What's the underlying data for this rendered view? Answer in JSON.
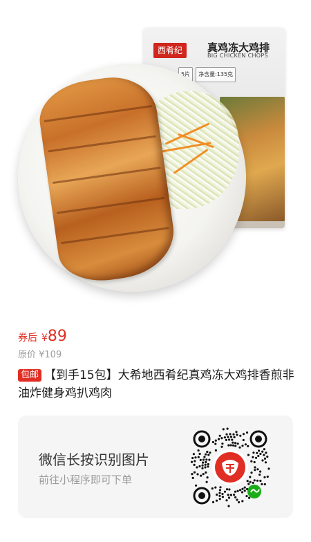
{
  "product": {
    "bag_brand": "西肴纪",
    "bag_title": "真鸡冻大鸡排",
    "bag_subtitle": "BIG CHICKEN CHOPS",
    "bag_cells": [
      "5片",
      "净含量:135克"
    ]
  },
  "price": {
    "prefix": "券后",
    "symbol": "¥",
    "value": "89",
    "original_label": "原价 ¥109"
  },
  "title": {
    "badge": "包邮",
    "text": "【到手15包】大希地西肴纪真鸡冻大鸡排香煎非油炸健身鸡扒鸡肉"
  },
  "mini_program": {
    "title": "微信长按识别图片",
    "subtitle": "前往小程序即可下单",
    "brand_color": "#e02e24",
    "icon": "pinduoduo-logo-icon"
  },
  "colors": {
    "accent": "#e02e24",
    "muted": "#9c9c9c",
    "text": "#1a1a1a"
  }
}
